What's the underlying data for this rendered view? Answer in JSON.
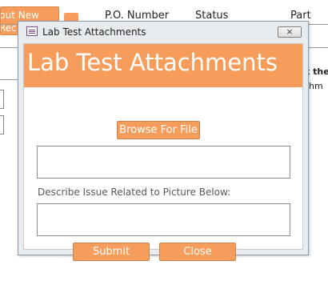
{
  "background_form": {
    "new_record_button": {
      "line1": "put New",
      "line2": "Rec"
    },
    "columns": [
      "P.O. Number",
      "Status",
      "Part Nu"
    ],
    "side_text": {
      "line1": "k the",
      "line2": "chm"
    }
  },
  "dialog": {
    "window_title": "Lab Test Attachments",
    "close_glyph": "⨯",
    "header_title": "Lab Test Attachments",
    "browse_label": "Browse For File",
    "file_path_value": "",
    "describe_label": "Describe Issue Related to Picture Below:",
    "description_value": "",
    "submit_label": "Submit",
    "close_label": "Close"
  },
  "colors": {
    "accent": "#f79d5c",
    "window_chrome": "#e9ecef"
  },
  "icons": {
    "form_icon": "form-icon",
    "close_icon": "close-icon"
  }
}
